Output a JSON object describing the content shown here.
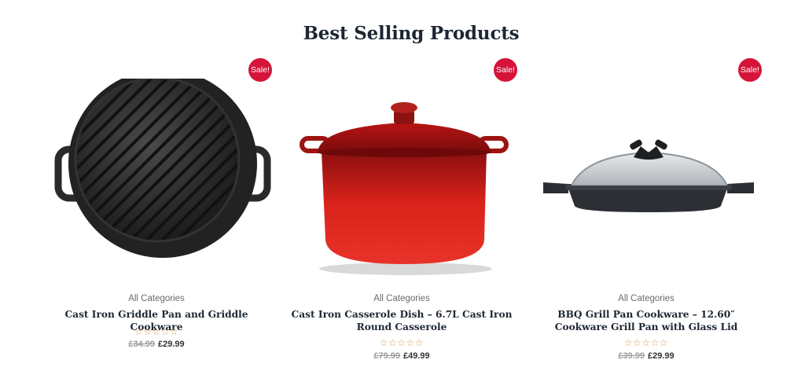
{
  "section": {
    "title": "Best Selling Products"
  },
  "products": [
    {
      "sale_badge": "Sale!",
      "image_icon": "griddle-pan-image",
      "category": "All Categories",
      "name": "Cast Iron Griddle Pan and Griddle Cookware",
      "rating_stars": "☆☆☆☆☆",
      "rating_value": 0,
      "old_price": "£34.99",
      "new_price": "£29.99"
    },
    {
      "sale_badge": "Sale!",
      "image_icon": "casserole-dish-image",
      "category": "All Categories",
      "name": "Cast Iron Casserole Dish – 6.7L Cast Iron Round Casserole",
      "rating_stars": "☆☆☆☆☆",
      "rating_value": 0,
      "old_price": "£79.99",
      "new_price": "£49.99"
    },
    {
      "sale_badge": "Sale!",
      "image_icon": "grill-pan-with-lid-image",
      "category": "All Categories",
      "name": "BBQ Grill Pan Cookware – 12.60″ Cookware Grill Pan with Glass Lid",
      "rating_stars": "☆☆☆☆☆",
      "rating_value": 0,
      "old_price": "£39.99",
      "new_price": "£29.99"
    }
  ],
  "colors": {
    "sale_badge": "#d6143a",
    "title_text": "#1d2733",
    "rating_stars": "#d89a4a"
  }
}
